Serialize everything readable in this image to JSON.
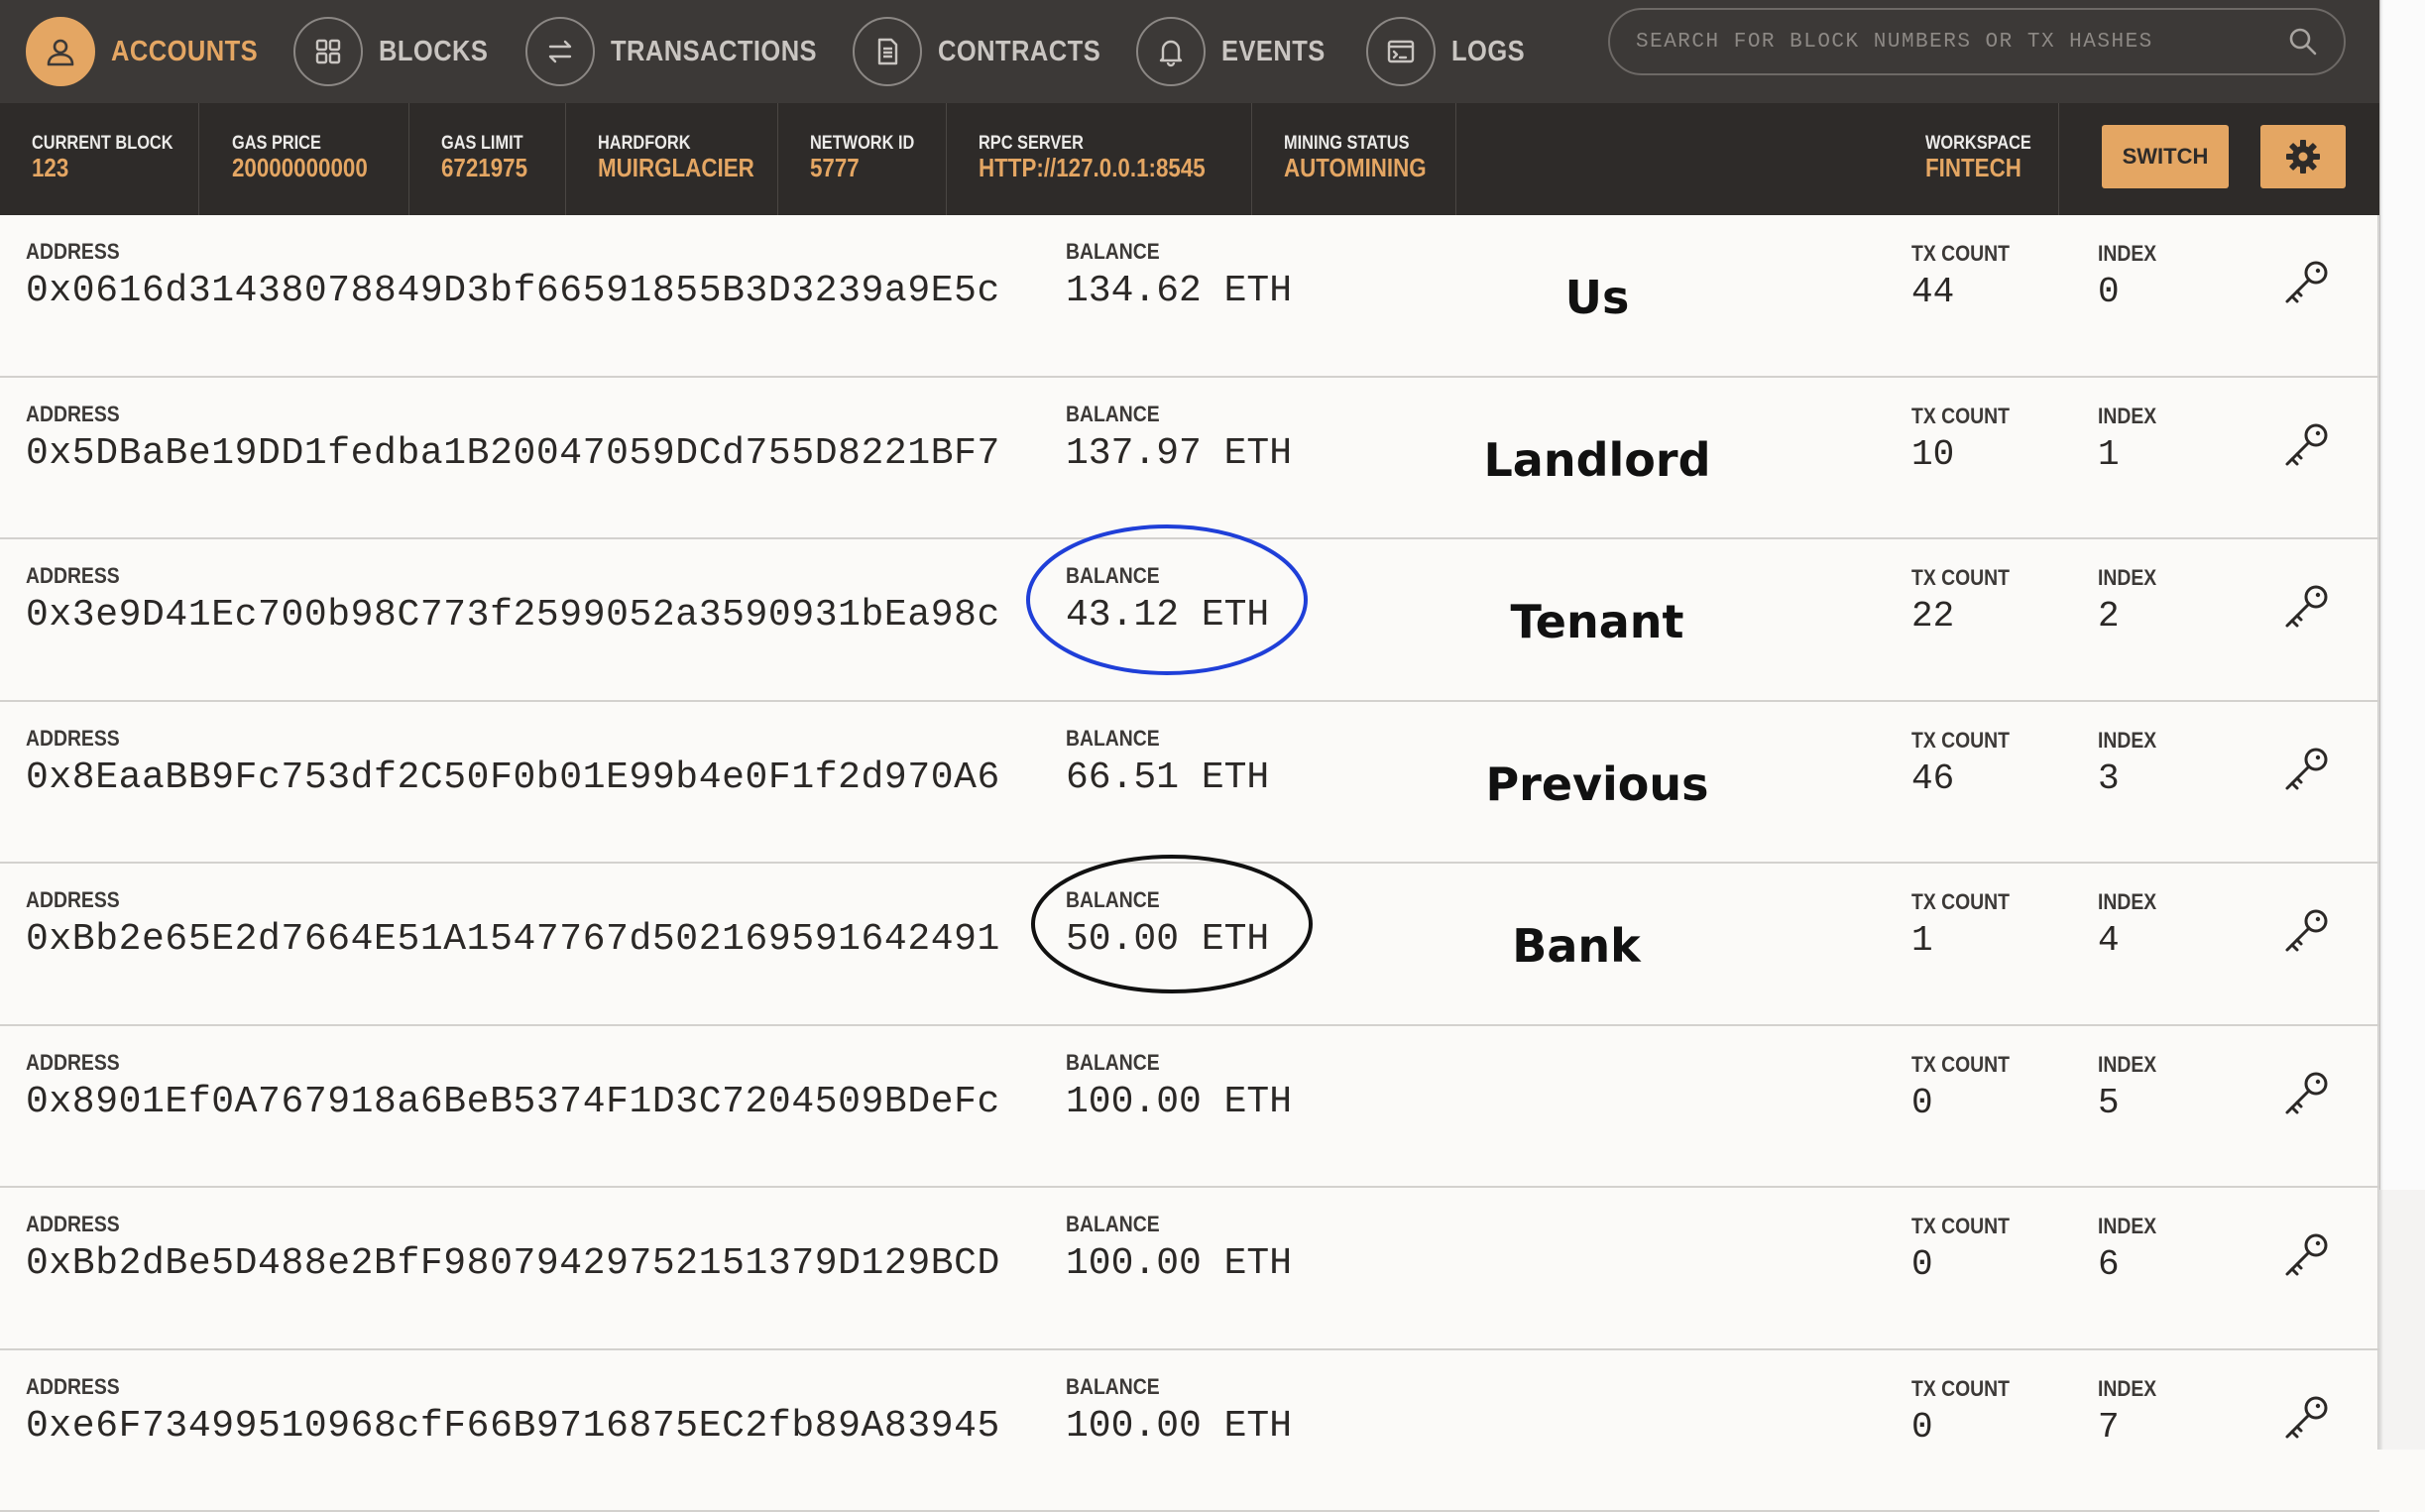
{
  "nav": {
    "items": [
      {
        "label": "ACCOUNTS",
        "icon": "user-icon",
        "active": true
      },
      {
        "label": "BLOCKS",
        "icon": "grid-icon",
        "active": false
      },
      {
        "label": "TRANSACTIONS",
        "icon": "swap-arrows-icon",
        "active": false
      },
      {
        "label": "CONTRACTS",
        "icon": "document-icon",
        "active": false
      },
      {
        "label": "EVENTS",
        "icon": "bell-icon",
        "active": false
      },
      {
        "label": "LOGS",
        "icon": "terminal-icon",
        "active": false
      }
    ],
    "search_placeholder": "SEARCH FOR BLOCK NUMBERS OR TX HASHES"
  },
  "stats": {
    "current_block": {
      "label": "CURRENT BLOCK",
      "value": "123"
    },
    "gas_price": {
      "label": "GAS PRICE",
      "value": "20000000000"
    },
    "gas_limit": {
      "label": "GAS LIMIT",
      "value": "6721975"
    },
    "hardfork": {
      "label": "HARDFORK",
      "value": "MUIRGLACIER"
    },
    "network_id": {
      "label": "NETWORK ID",
      "value": "5777"
    },
    "rpc_server": {
      "label": "RPC SERVER",
      "value": "HTTP://127.0.0.1:8545"
    },
    "mining_status": {
      "label": "MINING STATUS",
      "value": "AUTOMINING"
    },
    "workspace": {
      "label": "WORKSPACE",
      "value": "FINTECH"
    },
    "switch_label": "SWITCH"
  },
  "labels": {
    "address": "ADDRESS",
    "balance": "BALANCE",
    "tx_count": "TX COUNT",
    "index": "INDEX"
  },
  "accounts": [
    {
      "address": "0x0616d31438078849D3bf66591855B3D3239a9E5c",
      "balance": "134.62 ETH",
      "tx_count": "44",
      "index": "0",
      "annotation": "Us"
    },
    {
      "address": "0x5DBaBe19DD1fedba1B20047059DCd755D8221BF7",
      "balance": "137.97 ETH",
      "tx_count": "10",
      "index": "1",
      "annotation": "Landlord"
    },
    {
      "address": "0x3e9D41Ec700b98C773f2599052a3590931bEa98c",
      "balance": "43.12 ETH",
      "tx_count": "22",
      "index": "2",
      "annotation": "Tenant"
    },
    {
      "address": "0x8EaaBB9Fc753df2C50F0b01E99b4e0F1f2d970A6",
      "balance": "66.51 ETH",
      "tx_count": "46",
      "index": "3",
      "annotation": "Previous"
    },
    {
      "address": "0xBb2e65E2d7664E51A1547767d502169591642491",
      "balance": "50.00 ETH",
      "tx_count": "1",
      "index": "4",
      "annotation": "Bank"
    },
    {
      "address": "0x8901Ef0A767918a6BeB5374F1D3C7204509BDeFc",
      "balance": "100.00 ETH",
      "tx_count": "0",
      "index": "5",
      "annotation": ""
    },
    {
      "address": "0xBb2dBe5D488e2BfF98079429752151379D129BCD",
      "balance": "100.00 ETH",
      "tx_count": "0",
      "index": "6",
      "annotation": ""
    },
    {
      "address": "0xe6F73499510968cfF66B9716875EC2fb89A83945",
      "balance": "100.00 ETH",
      "tx_count": "0",
      "index": "7",
      "annotation": ""
    }
  ],
  "colors": {
    "accent": "#e4a663",
    "nav_bg": "#3c3937",
    "stats_bg": "#2e2b29",
    "circle_blue": "#1f3fd8",
    "circle_black": "#111111"
  }
}
